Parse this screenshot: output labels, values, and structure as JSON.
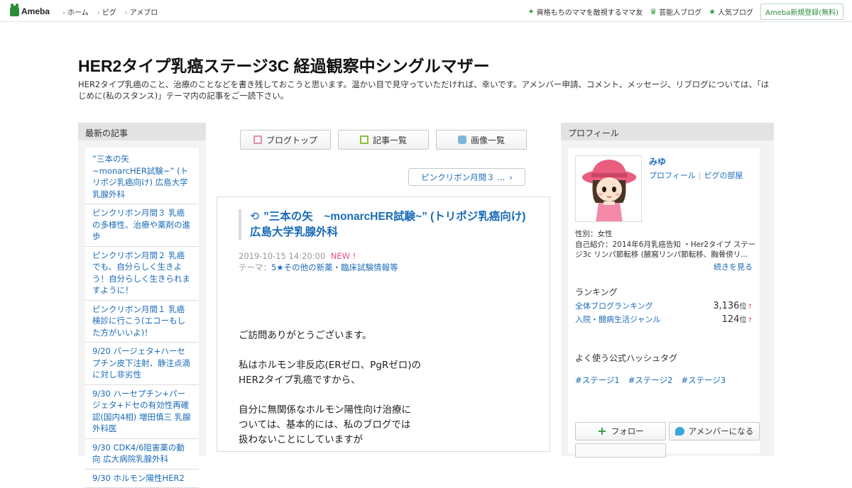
{
  "topbar": {
    "logo_text": "Ameba",
    "nav": [
      "ホーム",
      "ピグ",
      "アメブロ"
    ],
    "right_links": [
      {
        "icon": "sparkle-icon",
        "label": "資格もちのママを敵視するママ友"
      },
      {
        "icon": "crown-icon",
        "label": "芸能人ブログ"
      },
      {
        "icon": "star-icon",
        "label": "人気ブログ"
      }
    ],
    "signup_label": "Ameba新規登録(無料)"
  },
  "header": {
    "title": "HER2タイプ乳癌ステージ3C 経過観察中シングルマザー",
    "description": "HER2タイプ乳癌のこと、治療のことなどを書き残しておこうと思います。温かい目で見守っていただければ、幸いです。アメンバー申請、コメント、メッセージ、リブログについては、「はじめに(私のスタンス)」テーマ内の記事をご一読下さい。"
  },
  "sidebar_left": {
    "heading": "最新の記事",
    "recent": [
      "”三本の矢　~monarcHER試験~” (トリポジ乳癌向け) 広島大学乳腺外科",
      "ピンクリボン月間３ 乳癌の多様性、治療や薬剤の進歩",
      "ピンクリボン月間２ 乳癌でも、自分らしく生きよう！自分らしく生きられますように！",
      "ピンクリボン月間１ 乳癌検診に行こう(エコーもした方がいいよ)！",
      "9/20 パージェタ+ハーセプチン皮下注射、静注点滴に対し非劣性",
      "9/30 ハーセプチン+パージェタ+ドセの有効性再確認(国内4相) 増田慎三 乳腺外科医",
      "9/30 CDK4/6阻害薬の動向 広大病院乳腺外科",
      "9/30 ホルモン陽性HER2"
    ]
  },
  "center": {
    "tabs": [
      {
        "icon": "blog-top-icon",
        "label": "ブログトップ"
      },
      {
        "icon": "article-list-icon",
        "label": "記事一覧"
      },
      {
        "icon": "camera-icon",
        "label": "画像一覧"
      }
    ],
    "next_article": "ピンクリボン月間３ ...",
    "article": {
      "title": "”三本の矢　~monarcHER試験~” (トリポジ乳癌向け) 広島大学乳腺外科",
      "date": "2019-10-15 14:20:00",
      "new_label": "NEW !",
      "theme_label": "テーマ：",
      "theme": "5★その他の新薬・臨床試験情報等",
      "body": [
        "ご訪問ありがとうございます。",
        "私はホルモン非反応(ERゼロ、PgRゼロ)の\nHER2タイプ乳癌ですから、",
        "自分に無関係なホルモン陽性向け治療に\nついては、基本的には、私のブログでは\n扱わないことにしていますが"
      ]
    }
  },
  "sidebar_right": {
    "heading": "プロフィール",
    "name": "みゆ",
    "links": [
      "プロフィール",
      "ピグの部屋"
    ],
    "gender": "性別：女性",
    "bio": "自己紹介：2014年6月乳癌告知 ・Her2タイプ ステージ3c リンパ節転移 (腋窩リンパ節転移、胸骨傍リ...",
    "more_label": "続きを見る",
    "ranking_heading": "ランキング",
    "rankings": [
      {
        "label": "全体ブログランキング",
        "value": "3,136",
        "unit": "位",
        "trend": "↑"
      },
      {
        "label": "入院・闘病生活ジャンル",
        "value": "124",
        "unit": "位",
        "trend": "↑"
      }
    ],
    "hashtag_heading": "よく使う公式ハッシュタグ",
    "hashtags": [
      "#ステージ1",
      "#ステージ2",
      "#ステージ3"
    ],
    "follow_label": "フォロー",
    "amember_label": "アメンバーになる"
  }
}
